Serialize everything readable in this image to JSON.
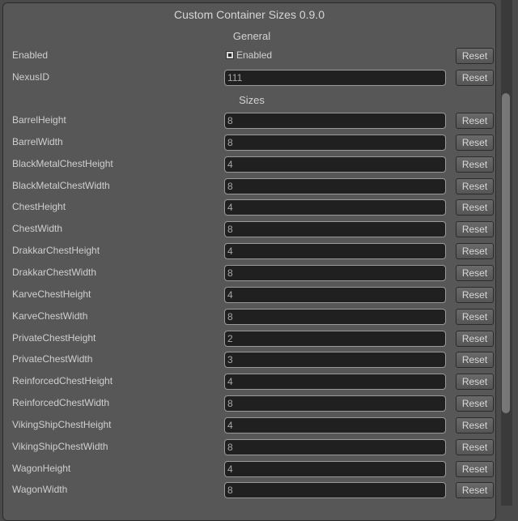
{
  "window": {
    "title": "Custom Container Sizes 0.9.0"
  },
  "sections": {
    "general": "General",
    "sizes": "Sizes"
  },
  "reset_label": "Reset",
  "general": {
    "enabled": {
      "label": "Enabled",
      "checkbox_label": "Enabled",
      "checked": true
    },
    "nexus": {
      "label": "NexusID",
      "value": "111"
    }
  },
  "sizes": [
    {
      "label": "BarrelHeight",
      "value": "8"
    },
    {
      "label": "BarrelWidth",
      "value": "8"
    },
    {
      "label": "BlackMetalChestHeight",
      "value": "4"
    },
    {
      "label": "BlackMetalChestWidth",
      "value": "8"
    },
    {
      "label": "ChestHeight",
      "value": "4"
    },
    {
      "label": "ChestWidth",
      "value": "8"
    },
    {
      "label": "DrakkarChestHeight",
      "value": "4"
    },
    {
      "label": "DrakkarChestWidth",
      "value": "8"
    },
    {
      "label": "KarveChestHeight",
      "value": "4"
    },
    {
      "label": "KarveChestWidth",
      "value": "8"
    },
    {
      "label": "PrivateChestHeight",
      "value": "2"
    },
    {
      "label": "PrivateChestWidth",
      "value": "3"
    },
    {
      "label": "ReinforcedChestHeight",
      "value": "4"
    },
    {
      "label": "ReinforcedChestWidth",
      "value": "8"
    },
    {
      "label": "VikingShipChestHeight",
      "value": "4"
    },
    {
      "label": "VikingShipChestWidth",
      "value": "8"
    },
    {
      "label": "WagonHeight",
      "value": "4"
    },
    {
      "label": "WagonWidth",
      "value": "8"
    }
  ]
}
